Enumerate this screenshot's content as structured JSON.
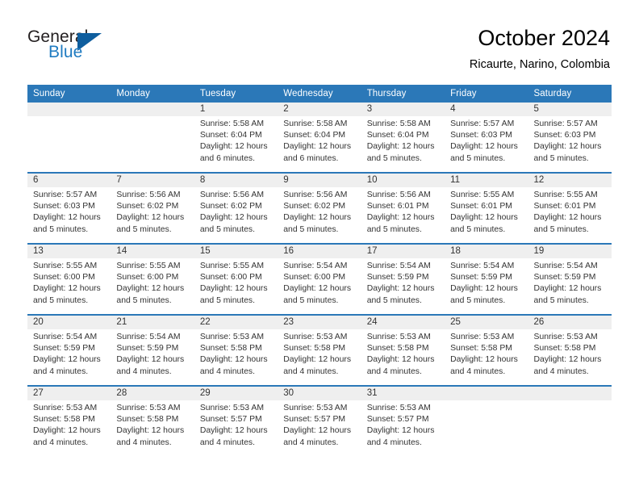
{
  "brand": {
    "word_general": "General",
    "word_blue": "Blue",
    "triangle_color": "#0f5e9e",
    "blue_text_color": "#1f7bc1"
  },
  "header": {
    "title": "October 2024",
    "subtitle": "Ricaurte, Narino, Colombia"
  },
  "theme": {
    "header_blue": "#2b78b8",
    "daynum_band": "#efefef",
    "cell_background": "#ffffff",
    "text_color": "#333333"
  },
  "calendar": {
    "weekday_headers": [
      "Sunday",
      "Monday",
      "Tuesday",
      "Wednesday",
      "Thursday",
      "Friday",
      "Saturday"
    ],
    "weeks": [
      [
        {
          "day": "",
          "lines": []
        },
        {
          "day": "",
          "lines": []
        },
        {
          "day": "1",
          "lines": [
            "Sunrise: 5:58 AM",
            "Sunset: 6:04 PM",
            "Daylight: 12 hours",
            "and 6 minutes."
          ]
        },
        {
          "day": "2",
          "lines": [
            "Sunrise: 5:58 AM",
            "Sunset: 6:04 PM",
            "Daylight: 12 hours",
            "and 6 minutes."
          ]
        },
        {
          "day": "3",
          "lines": [
            "Sunrise: 5:58 AM",
            "Sunset: 6:04 PM",
            "Daylight: 12 hours",
            "and 5 minutes."
          ]
        },
        {
          "day": "4",
          "lines": [
            "Sunrise: 5:57 AM",
            "Sunset: 6:03 PM",
            "Daylight: 12 hours",
            "and 5 minutes."
          ]
        },
        {
          "day": "5",
          "lines": [
            "Sunrise: 5:57 AM",
            "Sunset: 6:03 PM",
            "Daylight: 12 hours",
            "and 5 minutes."
          ]
        }
      ],
      [
        {
          "day": "6",
          "lines": [
            "Sunrise: 5:57 AM",
            "Sunset: 6:03 PM",
            "Daylight: 12 hours",
            "and 5 minutes."
          ]
        },
        {
          "day": "7",
          "lines": [
            "Sunrise: 5:56 AM",
            "Sunset: 6:02 PM",
            "Daylight: 12 hours",
            "and 5 minutes."
          ]
        },
        {
          "day": "8",
          "lines": [
            "Sunrise: 5:56 AM",
            "Sunset: 6:02 PM",
            "Daylight: 12 hours",
            "and 5 minutes."
          ]
        },
        {
          "day": "9",
          "lines": [
            "Sunrise: 5:56 AM",
            "Sunset: 6:02 PM",
            "Daylight: 12 hours",
            "and 5 minutes."
          ]
        },
        {
          "day": "10",
          "lines": [
            "Sunrise: 5:56 AM",
            "Sunset: 6:01 PM",
            "Daylight: 12 hours",
            "and 5 minutes."
          ]
        },
        {
          "day": "11",
          "lines": [
            "Sunrise: 5:55 AM",
            "Sunset: 6:01 PM",
            "Daylight: 12 hours",
            "and 5 minutes."
          ]
        },
        {
          "day": "12",
          "lines": [
            "Sunrise: 5:55 AM",
            "Sunset: 6:01 PM",
            "Daylight: 12 hours",
            "and 5 minutes."
          ]
        }
      ],
      [
        {
          "day": "13",
          "lines": [
            "Sunrise: 5:55 AM",
            "Sunset: 6:00 PM",
            "Daylight: 12 hours",
            "and 5 minutes."
          ]
        },
        {
          "day": "14",
          "lines": [
            "Sunrise: 5:55 AM",
            "Sunset: 6:00 PM",
            "Daylight: 12 hours",
            "and 5 minutes."
          ]
        },
        {
          "day": "15",
          "lines": [
            "Sunrise: 5:55 AM",
            "Sunset: 6:00 PM",
            "Daylight: 12 hours",
            "and 5 minutes."
          ]
        },
        {
          "day": "16",
          "lines": [
            "Sunrise: 5:54 AM",
            "Sunset: 6:00 PM",
            "Daylight: 12 hours",
            "and 5 minutes."
          ]
        },
        {
          "day": "17",
          "lines": [
            "Sunrise: 5:54 AM",
            "Sunset: 5:59 PM",
            "Daylight: 12 hours",
            "and 5 minutes."
          ]
        },
        {
          "day": "18",
          "lines": [
            "Sunrise: 5:54 AM",
            "Sunset: 5:59 PM",
            "Daylight: 12 hours",
            "and 5 minutes."
          ]
        },
        {
          "day": "19",
          "lines": [
            "Sunrise: 5:54 AM",
            "Sunset: 5:59 PM",
            "Daylight: 12 hours",
            "and 5 minutes."
          ]
        }
      ],
      [
        {
          "day": "20",
          "lines": [
            "Sunrise: 5:54 AM",
            "Sunset: 5:59 PM",
            "Daylight: 12 hours",
            "and 4 minutes."
          ]
        },
        {
          "day": "21",
          "lines": [
            "Sunrise: 5:54 AM",
            "Sunset: 5:59 PM",
            "Daylight: 12 hours",
            "and 4 minutes."
          ]
        },
        {
          "day": "22",
          "lines": [
            "Sunrise: 5:53 AM",
            "Sunset: 5:58 PM",
            "Daylight: 12 hours",
            "and 4 minutes."
          ]
        },
        {
          "day": "23",
          "lines": [
            "Sunrise: 5:53 AM",
            "Sunset: 5:58 PM",
            "Daylight: 12 hours",
            "and 4 minutes."
          ]
        },
        {
          "day": "24",
          "lines": [
            "Sunrise: 5:53 AM",
            "Sunset: 5:58 PM",
            "Daylight: 12 hours",
            "and 4 minutes."
          ]
        },
        {
          "day": "25",
          "lines": [
            "Sunrise: 5:53 AM",
            "Sunset: 5:58 PM",
            "Daylight: 12 hours",
            "and 4 minutes."
          ]
        },
        {
          "day": "26",
          "lines": [
            "Sunrise: 5:53 AM",
            "Sunset: 5:58 PM",
            "Daylight: 12 hours",
            "and 4 minutes."
          ]
        }
      ],
      [
        {
          "day": "27",
          "lines": [
            "Sunrise: 5:53 AM",
            "Sunset: 5:58 PM",
            "Daylight: 12 hours",
            "and 4 minutes."
          ]
        },
        {
          "day": "28",
          "lines": [
            "Sunrise: 5:53 AM",
            "Sunset: 5:58 PM",
            "Daylight: 12 hours",
            "and 4 minutes."
          ]
        },
        {
          "day": "29",
          "lines": [
            "Sunrise: 5:53 AM",
            "Sunset: 5:57 PM",
            "Daylight: 12 hours",
            "and 4 minutes."
          ]
        },
        {
          "day": "30",
          "lines": [
            "Sunrise: 5:53 AM",
            "Sunset: 5:57 PM",
            "Daylight: 12 hours",
            "and 4 minutes."
          ]
        },
        {
          "day": "31",
          "lines": [
            "Sunrise: 5:53 AM",
            "Sunset: 5:57 PM",
            "Daylight: 12 hours",
            "and 4 minutes."
          ]
        },
        {
          "day": "",
          "lines": []
        },
        {
          "day": "",
          "lines": []
        }
      ]
    ]
  }
}
